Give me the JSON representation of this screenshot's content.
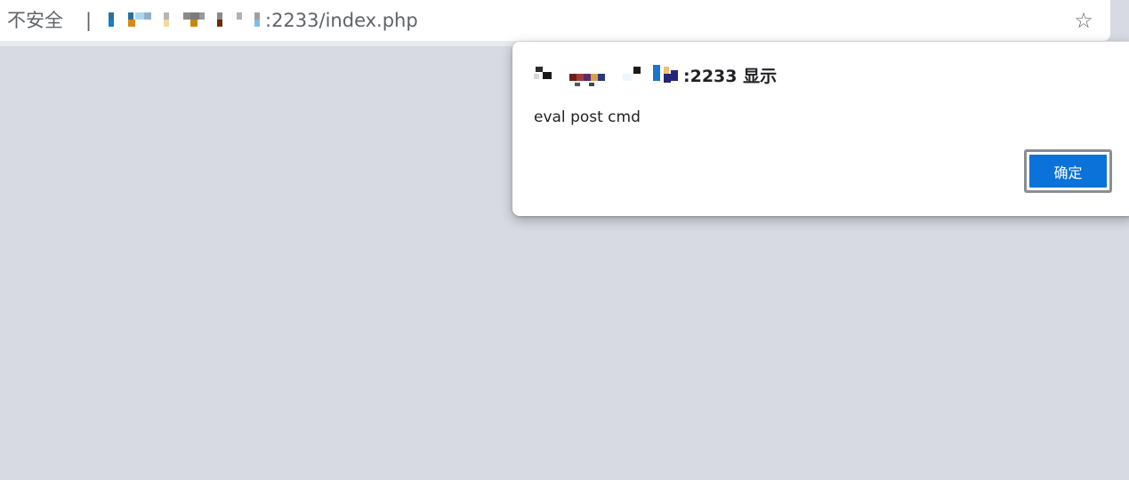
{
  "address_bar": {
    "security_label": "不安全",
    "separator": "|",
    "url_visible": ":2233/index.php",
    "bookmark_icon": "star-icon"
  },
  "dialog": {
    "title_visible": ":2233 显示",
    "message": "eval post cmd",
    "ok_label": "确定"
  },
  "colors": {
    "page_background": "#d7dae2",
    "button_primary": "#0a72d8",
    "address_bar": "#ffffff"
  }
}
